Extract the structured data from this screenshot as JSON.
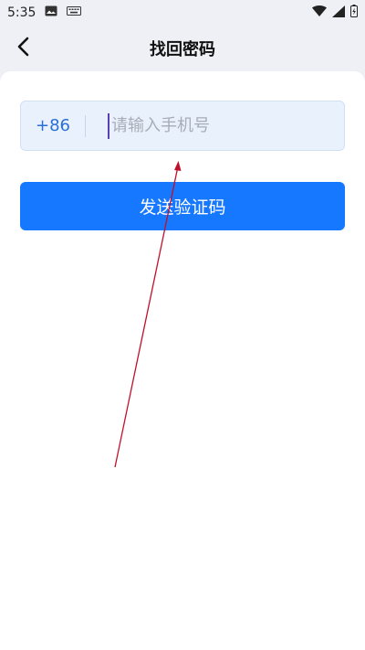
{
  "status_bar": {
    "time": "5:35"
  },
  "header": {
    "title": "找回密码"
  },
  "form": {
    "country_code": "+86",
    "phone_placeholder": "请输入手机号",
    "phone_value": ""
  },
  "actions": {
    "send_code_label": "发送验证码"
  },
  "colors": {
    "primary": "#1677ff",
    "input_bg": "#e9f1fd",
    "country_code": "#2a6fd6",
    "annotation_arrow": "#c0102a"
  },
  "icons": {
    "status_left": [
      "image-icon",
      "keyboard-icon"
    ],
    "status_right": [
      "wifi-icon",
      "signal-icon",
      "battery-icon"
    ],
    "nav": "chevron-left-icon"
  }
}
